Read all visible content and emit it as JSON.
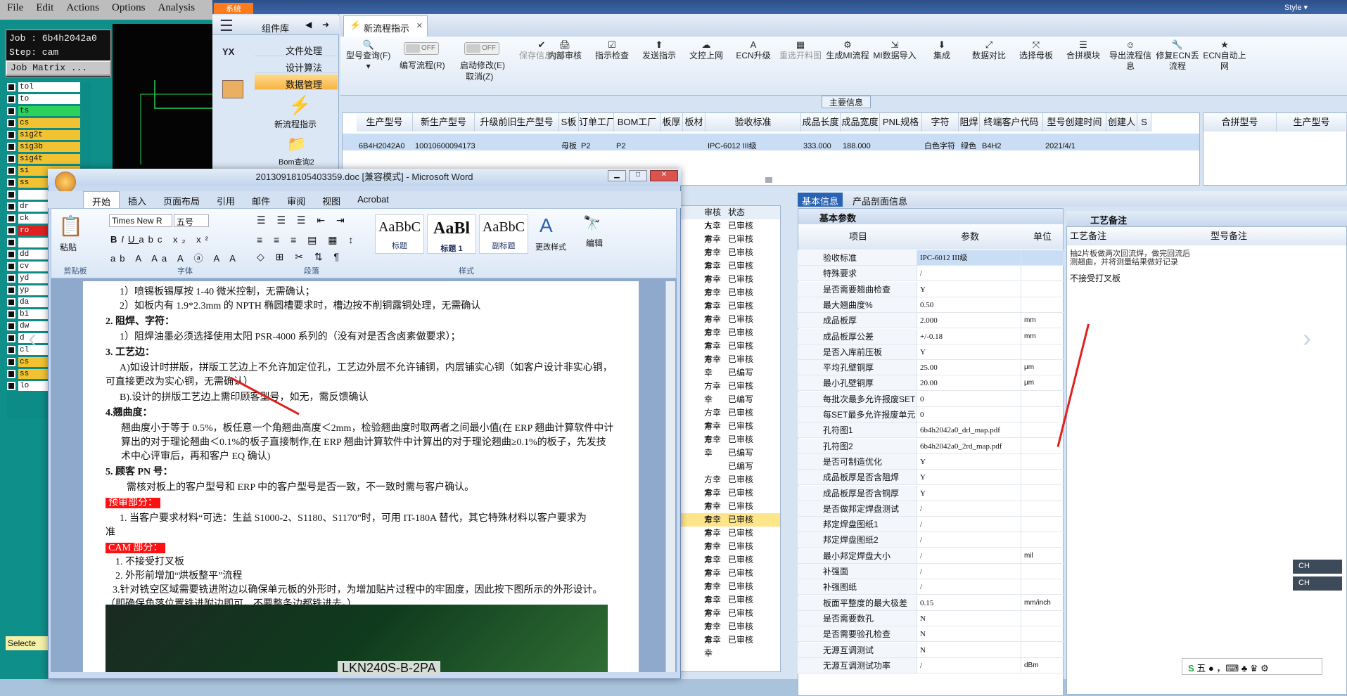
{
  "cam": {
    "menu": [
      "File",
      "Edit",
      "Actions",
      "Options",
      "Analysis"
    ],
    "job": "Job : 6b4h2042a0",
    "step": "Step: cam",
    "job_matrix": "Job Matrix ...",
    "layers": [
      "tol",
      "to",
      "ts",
      "cs",
      "sig2t",
      "sig3b",
      "sig4t",
      "si",
      "ss",
      "",
      "dr",
      "ck",
      "ro",
      "",
      "dd",
      "cv",
      "yd",
      "yp",
      "da",
      "bi",
      "dw",
      "d",
      "cl",
      "cs",
      "ss",
      "lo"
    ],
    "selected": "Selecte"
  },
  "erp": {
    "sys_tag": "系统",
    "style_menu": "Style ▾",
    "lib_title": "组件库",
    "lib_items": [
      "文件处理",
      "设计算法",
      "数据管理"
    ],
    "lib_new_flow": "新流程指示",
    "lib_bom": "Bom查询2",
    "tab_title": "新流程指示",
    "toolbar": {
      "type_query": "型号查询(F)",
      "off1": "OFF",
      "write_flow": "编写流程(R)",
      "off2": "OFF",
      "start_modify": "启动修改(E)",
      "cancel": "取消(Z)",
      "save_info": "保存信息(S)",
      "items": [
        "内部审核",
        "指示检查",
        "发送指示",
        "文控上网",
        "ECN升级",
        "重选开料图",
        "生成MI流程",
        "MI数据导入",
        "集成",
        "数据对比",
        "选择母板",
        "合拼模块",
        "导出流程信息",
        "修复ECN丢流程",
        "ECN自动上网"
      ]
    },
    "main_info": "主要信息",
    "grid_headers": [
      "生产型号",
      "新生产型号",
      "升级前旧生产型号",
      "S板",
      "订单工厂",
      "BOM工厂",
      "板厚",
      "板材",
      "验收标准",
      "成品长度",
      "成品宽度",
      "PNL规格",
      "字符",
      "阻焊",
      "终端客户代码",
      "型号创建时间",
      "创建人",
      "S"
    ],
    "grid_row": [
      "6B4H2042A0",
      "10010600094173",
      "",
      "母板",
      "P2",
      "P2",
      "",
      "",
      "IPC-6012 III级",
      "333.000",
      "188.000",
      "",
      "白色字符",
      "绿色",
      "B4H2",
      "2021/4/1",
      "",
      ""
    ],
    "right_headers": [
      "合拼型号",
      "生产型号"
    ],
    "list_headers": [
      "审核人",
      "状态"
    ],
    "list_rows": [
      [
        "方幸幸",
        "已审核"
      ],
      [
        "方幸幸",
        "已审核"
      ],
      [
        "方幸幸",
        "已审核"
      ],
      [
        "方幸幸",
        "已审核"
      ],
      [
        "方幸幸",
        "已审核"
      ],
      [
        "方幸幸",
        "已审核"
      ],
      [
        "方幸幸",
        "已审核"
      ],
      [
        "方幸幸",
        "已审核"
      ],
      [
        "方幸幸",
        "已审核"
      ],
      [
        "方幸幸",
        "已审核"
      ],
      [
        "方幸幸",
        "已审核"
      ],
      [
        "",
        "已编写"
      ],
      [
        "方幸幸",
        "已审核"
      ],
      [
        "",
        "已编写"
      ],
      [
        "方幸幸",
        "已审核"
      ],
      [
        "方幸幸",
        "已审核"
      ],
      [
        "方幸幸",
        "已审核"
      ],
      [
        "",
        "已编写"
      ],
      [
        "",
        "已编写"
      ],
      [
        "方幸幸",
        "已审核"
      ],
      [
        "方幸幸",
        "已审核"
      ],
      [
        "方幸幸",
        "已审核"
      ],
      [
        "方幸幸",
        "已审核"
      ],
      [
        "方幸幸",
        "已审核"
      ],
      [
        "方幸幸",
        "已审核"
      ],
      [
        "方幸幸",
        "已审核"
      ],
      [
        "方幸幸",
        "已审核"
      ],
      [
        "方幸幸",
        "已审核"
      ],
      [
        "方幸幸",
        "已审核"
      ],
      [
        "方幸幸",
        "已审核"
      ],
      [
        "方幸幸",
        "已审核"
      ],
      [
        "方幸幸",
        "已审核"
      ]
    ],
    "panel_tabs": [
      "基本信息",
      "产品剖面信息"
    ],
    "basic_params": "基本参数",
    "param_headers": [
      "项目",
      "参数",
      "单位"
    ],
    "params": [
      [
        "验收标准",
        "IPC-6012 III级",
        ""
      ],
      [
        "特殊要求",
        "/",
        ""
      ],
      [
        "是否需要翘曲检查",
        "Y",
        ""
      ],
      [
        "最大翘曲度%",
        "0.50",
        ""
      ],
      [
        "成品板厚",
        "2.000",
        "mm"
      ],
      [
        "成品板厚公差",
        "+/-0.18",
        "mm"
      ],
      [
        "是否入库前压板",
        "Y",
        ""
      ],
      [
        "平均孔壁铜厚",
        "25.00",
        "μm"
      ],
      [
        "最小孔壁铜厚",
        "20.00",
        "μm"
      ],
      [
        "每批次最多允许报废SET",
        "0",
        ""
      ],
      [
        "每SET最多允许报废单元",
        "0",
        ""
      ],
      [
        "孔符图1",
        "6b4h2042a0_drl_map.pdf",
        ""
      ],
      [
        "孔符图2",
        "6b4h2042a0_2rd_map.pdf",
        ""
      ],
      [
        "是否可制造优化",
        "Y",
        ""
      ],
      [
        "成品板厚是否含阻焊",
        "Y",
        ""
      ],
      [
        "成品板厚是否含铜厚",
        "Y",
        ""
      ],
      [
        "是否做邦定焊盘测试",
        "/",
        ""
      ],
      [
        "邦定焊盘图纸1",
        "/",
        ""
      ],
      [
        "邦定焊盘图纸2",
        "/",
        ""
      ],
      [
        "最小邦定焊盘大小",
        "/",
        "mil"
      ],
      [
        "补强面",
        "/",
        ""
      ],
      [
        "补强图纸",
        "/",
        ""
      ],
      [
        "板面平整度的最大极差",
        "0.15",
        "mm/inch"
      ],
      [
        "是否需要数孔",
        "N",
        ""
      ],
      [
        "是否需要验孔检查",
        "N",
        ""
      ],
      [
        "无源互调测试",
        "N",
        ""
      ],
      [
        "无源互调测试功率",
        "/",
        "dBm"
      ]
    ],
    "proc_tab": "工艺备注",
    "proc_headers": [
      "工艺备注",
      "型号备注"
    ],
    "proc_note1": "抽2片板做两次回流焊，做完回流后测翘曲，并将测量结果做好记录",
    "proc_note2": "不接受打叉板",
    "ime": "五 ● ，⌨ ♣ ♛ ⚙",
    "ch1": "CH",
    "ch2": "CH"
  },
  "word": {
    "title": "20130918105403359.doc [兼容模式] - Microsoft Word",
    "tabs": [
      "开始",
      "插入",
      "页面布局",
      "引用",
      "邮件",
      "审阅",
      "视图",
      "Acrobat"
    ],
    "font_name": "Times New R",
    "font_size": "五号",
    "groups": [
      "剪贴板",
      "字体",
      "段落",
      "样式"
    ],
    "paste": "粘贴",
    "styles": [
      {
        "sample": "AaBbC",
        "name": "标题"
      },
      {
        "sample": "AaBl",
        "name": "标题 1"
      },
      {
        "sample": "AaBbC",
        "name": "副标题"
      }
    ],
    "change_style": "更改样式",
    "edit": "编辑",
    "lines": [
      "1）喷锡板锡厚按 1-40 微米控制，无需确认；",
      "2）如板内有 1.9*2.3mm 的 NPTH 椭圆槽要求时，槽边按不削铜露铜处理，无需确认",
      "2.  阻焊、字符：",
      "1）阻焊油墨必须选择使用太阳 PSR-4000 系列的（没有对是否含卤素做要求）；",
      "3. 工艺边：",
      "A)如设计时拼版，拼版工艺边上不允许加定位孔，工艺边外层不允许铺铜，内层铺实心铜（如客户设计非实心铜，",
      "可直接更改为实心铜，无需确认）",
      "B).设计的拼版工艺边上需印顾客型号，如无，需反馈确认",
      "4.翘曲度：",
      "翘曲度小于等于 0.5%，板任意一个角翘曲高度＜2mm，检验翘曲度时取两者之间最小值(在 ERP 翘曲计算软件中计",
      "算出的对于理论翘曲＜0.1%的板子直接制作,在 ERP 翘曲计算软件中计算出的对于理论翘曲≥0.1%的板子，先发技",
      "术中心评审后，再和客户 EQ 确认)",
      "5. 顾客 PN 号：",
      "需核对板上的客户型号和 ERP 中的客户型号是否一致，不一致时需与客户确认。",
      "预审部分：",
      "1.  当客户要求材料“可选：生益 S1000-2、S1180、S1170”时，可用 IT-180A 替代，其它特殊材料以客户要求为",
      "准",
      "CAM 部分：",
      "1.  不接受打叉板",
      "2.  外形前增加“烘板整平”流程",
      "3.针对铣空区域需要铣进附边以确保单元板的外形时，为增加贴片过程中的牢固度，因此按下图所示的外形设计。",
      "（即确保角落位置铣进附边即可，不要整条边都铣进去。）"
    ],
    "photo_label": "LKN240S-B-2PA"
  }
}
